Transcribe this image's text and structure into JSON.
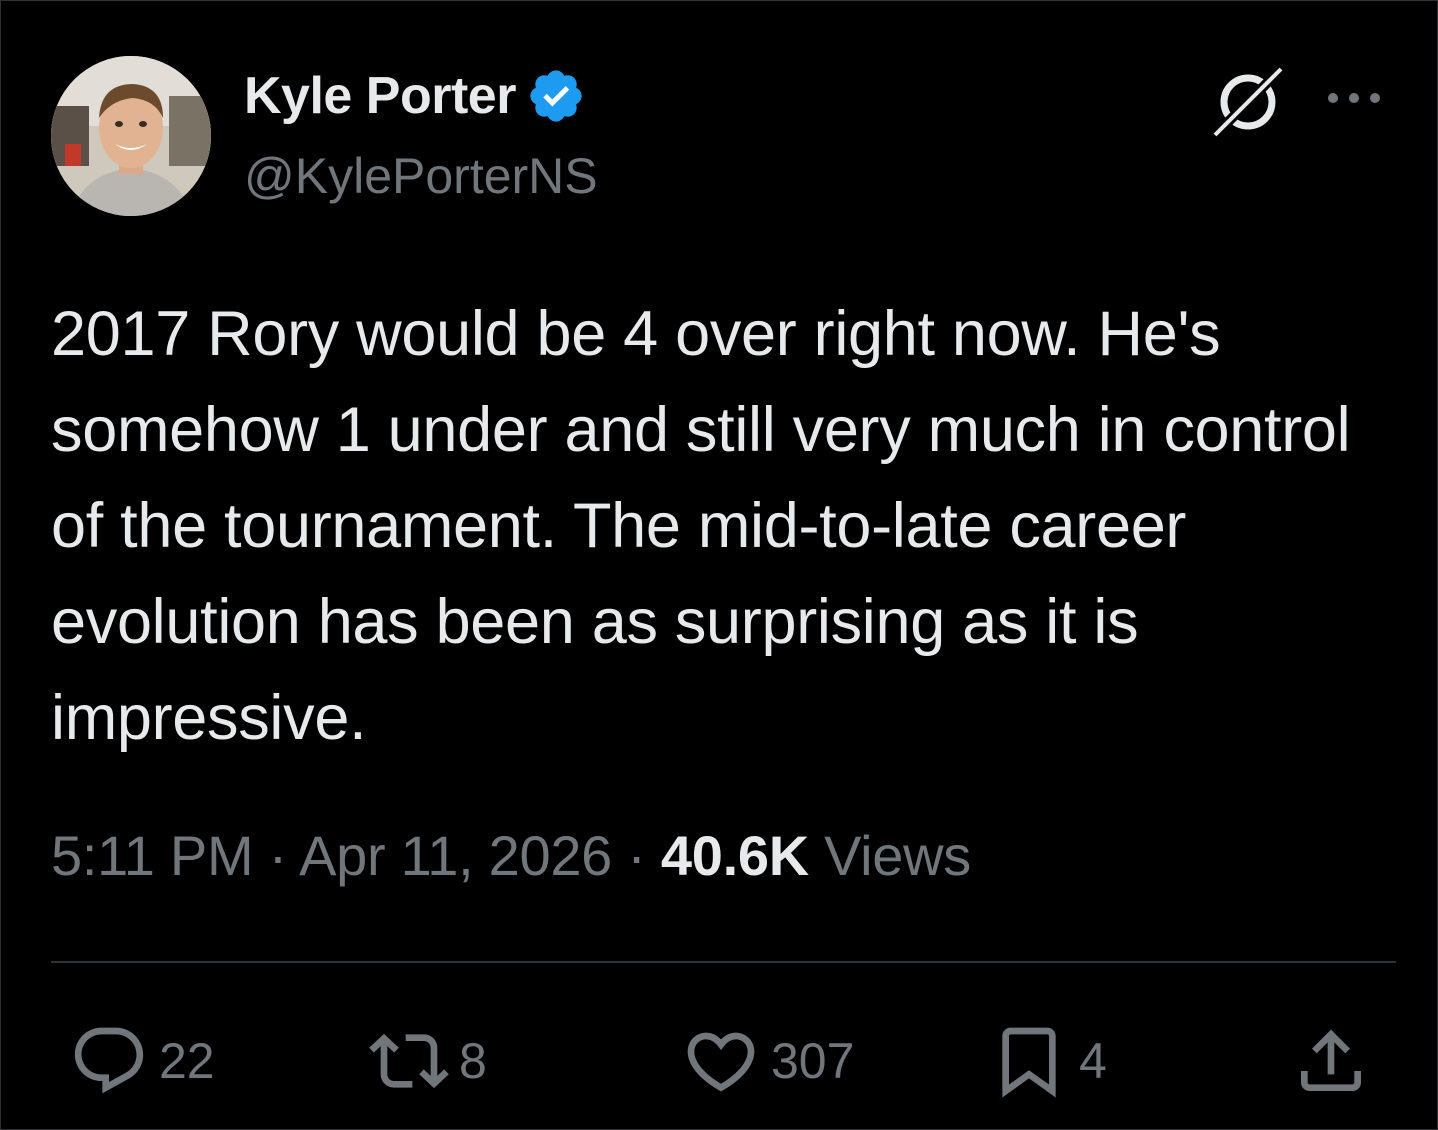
{
  "author": {
    "display_name": "Kyle Porter",
    "handle": "@KylePorterNS",
    "verified": true,
    "verified_color": "#1d9bf0"
  },
  "icons": {
    "top_right": [
      "grok-icon",
      "more-options-icon"
    ],
    "actions": [
      "reply-icon",
      "repost-icon",
      "like-icon",
      "bookmark-icon",
      "share-icon"
    ]
  },
  "tweet": {
    "text": "2017 Rory would be 4 over right now. He's somehow 1 under and still very much in control of the tournament. The mid-to-late career evolution has been as surprising as it is impressive."
  },
  "meta": {
    "time": "5:11 PM",
    "separator": "·",
    "date": "Apr 11, 2026",
    "views_count": "40.6K",
    "views_label": "Views"
  },
  "actions": {
    "replies": "22",
    "reposts": "8",
    "likes": "307",
    "bookmarks": "4"
  },
  "colors": {
    "background": "#000000",
    "text_primary": "#e7e9ea",
    "text_secondary": "#71767b",
    "divider": "#2f3336"
  }
}
